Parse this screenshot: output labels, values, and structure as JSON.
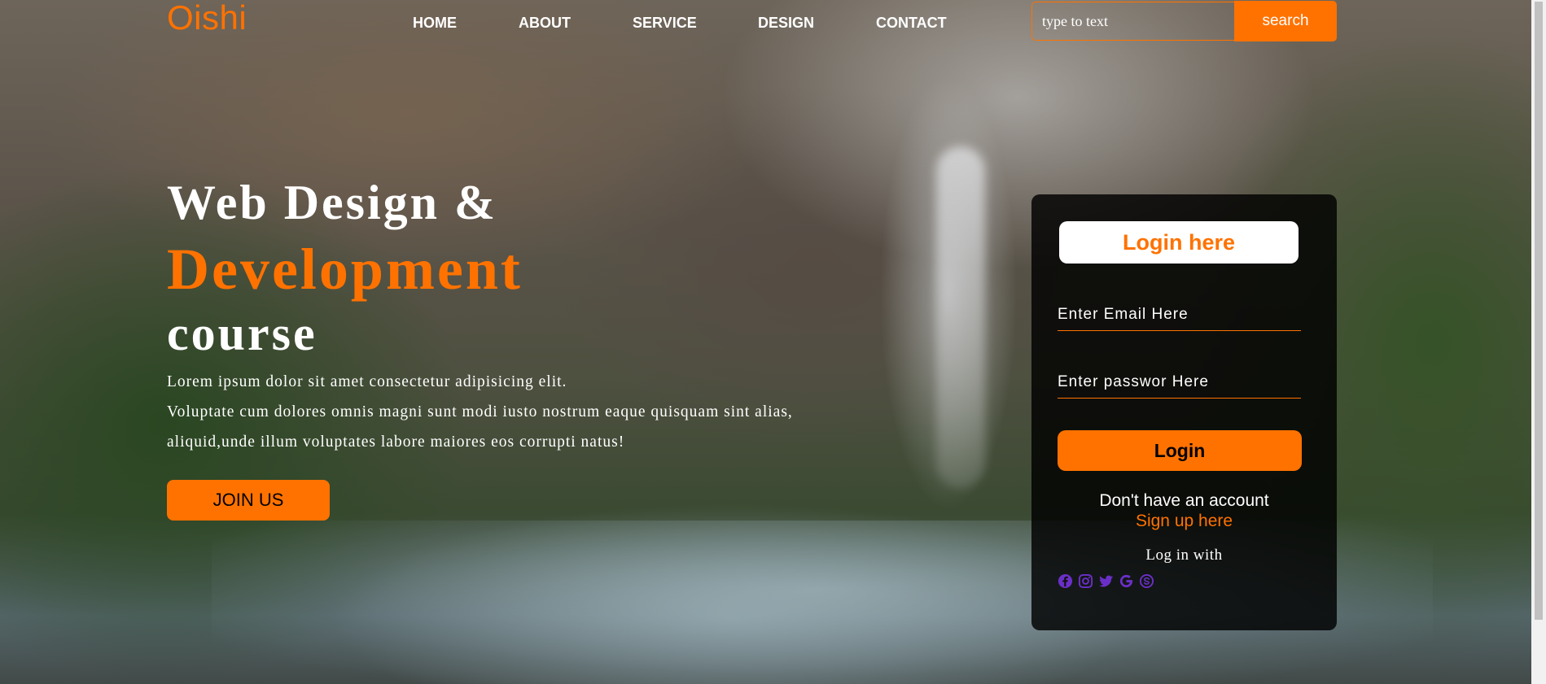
{
  "brand": {
    "logo": "Oishi",
    "accent_color": "#ff7200"
  },
  "nav": {
    "items": [
      {
        "label": "HOME"
      },
      {
        "label": "ABOUT"
      },
      {
        "label": "SERVICE"
      },
      {
        "label": "DESIGN"
      },
      {
        "label": "CONTACT"
      }
    ]
  },
  "search": {
    "placeholder": "type to text",
    "value": "",
    "button_label": "search"
  },
  "hero": {
    "line1": "Web Design &",
    "line2": "Development",
    "line3": "course",
    "paragraph": [
      "Lorem ipsum dolor sit amet consectetur adipisicing elit.",
      "Voluptate cum dolores omnis magni sunt modi iusto nostrum eaque quisquam sint alias,",
      "aliquid,unde illum voluptates labore maiores eos corrupti natus!"
    ],
    "cta_label": "JOIN US"
  },
  "login": {
    "title": "Login here",
    "email_placeholder": "Enter Email Here",
    "password_placeholder": "Enter passwor Here",
    "button_label": "Login",
    "no_account_text": "Don't have an account",
    "signup_link": "Sign up here",
    "login_with_text": "Log in with",
    "social_icons": [
      "facebook-icon",
      "instagram-icon",
      "twitter-icon",
      "google-icon",
      "skype-icon"
    ],
    "social_icon_color": "#6b2fc9"
  }
}
